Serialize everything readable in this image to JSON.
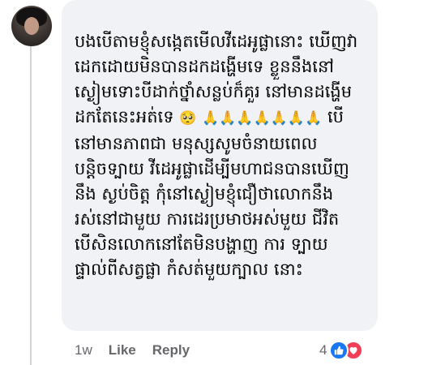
{
  "comment": {
    "lines": [
      "បងបើតាមខ្ញុំសង្កេតមើលវីដេអូផ្លានោះ",
      "ឃើញវាដេកដោយមិនបានដកដង្ហើមទេ",
      "ខ្លួននឹងនៅស្ងៀមទោះបីដាក់ថ្នាំសន្លប់ក៏គួរ",
      "នៅមានដង្ហើមដកតែនេះអត់ទេ"
    ],
    "emoji_sad": "🥺",
    "emoji_pray": "🙏🙏🙏🙏🙏🙏🙏",
    "lines_2": [
      "បើនៅមានភាពជា",
      "មនុស្សសូមចំនាយពេលបន្តិចទ្បាយ",
      "វីដេអូផ្លាដើម្បីមហាជនបានឃើញនឹង",
      "ស្ងប់ចិត្ត កុំនៅស្ងៀមខ្ញុំជឿថាលោកនឹង",
      "រស់នៅជាមួយ ការដេរប្រមាថអស់មួយ",
      "ជីវិតបើសិនលោកនៅតែមិនបង្ហាញ ការ",
      "ទ្បាយផ្ទាល់ពីសត្វផ្លា កំសត់មួយក្បាល",
      "នោះ"
    ]
  },
  "actions": {
    "time": "1w",
    "like_label": "Like",
    "reply_label": "Reply"
  },
  "reactions": {
    "count": "4",
    "types": [
      "like-icon",
      "love-icon"
    ],
    "like_color": "#1877f2",
    "love_color": "#f33e58"
  }
}
